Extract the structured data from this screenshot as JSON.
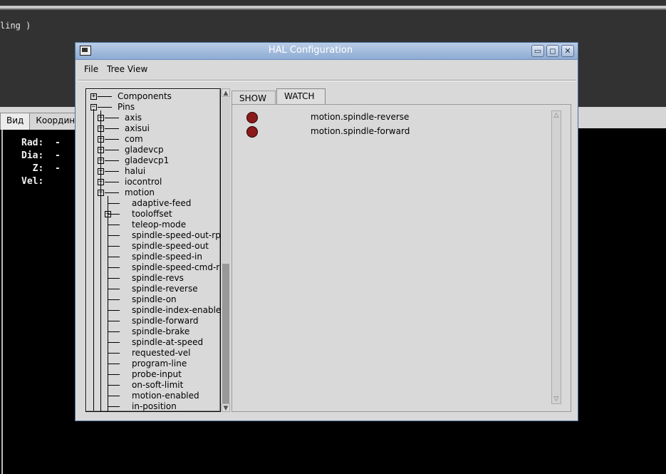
{
  "background": {
    "terminal_text": "ling )",
    "tabs": [
      {
        "label": "Вид"
      },
      {
        "label": "Координ"
      }
    ],
    "dro": [
      {
        "axis": "Rad:",
        "value": "-"
      },
      {
        "axis": "Dia:",
        "value": "-"
      },
      {
        "axis": "  Z:",
        "value": "-"
      },
      {
        "axis": "Vel:",
        "value": ""
      }
    ]
  },
  "window": {
    "title": "HAL Configuration",
    "controls": {
      "minimize": "▭",
      "maximize": "◻",
      "close": "✕"
    }
  },
  "menu": {
    "file": "File",
    "tree_view": "Tree View"
  },
  "tree": {
    "components": "Components",
    "pins": "Pins",
    "pin_groups": [
      {
        "label": "axis"
      },
      {
        "label": "axisui"
      },
      {
        "label": "com"
      },
      {
        "label": "gladevcp"
      },
      {
        "label": "gladevcp1"
      },
      {
        "label": "halui"
      },
      {
        "label": "iocontrol"
      },
      {
        "label": "motion"
      }
    ],
    "motion_children": [
      {
        "label": "adaptive-feed",
        "expandable": false
      },
      {
        "label": "tooloffset",
        "expandable": true
      },
      {
        "label": "teleop-mode",
        "expandable": false
      },
      {
        "label": "spindle-speed-out-rps",
        "expandable": false
      },
      {
        "label": "spindle-speed-out",
        "expandable": false
      },
      {
        "label": "spindle-speed-in",
        "expandable": false
      },
      {
        "label": "spindle-speed-cmd-rps",
        "expandable": false
      },
      {
        "label": "spindle-revs",
        "expandable": false
      },
      {
        "label": "spindle-reverse",
        "expandable": false
      },
      {
        "label": "spindle-on",
        "expandable": false
      },
      {
        "label": "spindle-index-enable",
        "expandable": false
      },
      {
        "label": "spindle-forward",
        "expandable": false
      },
      {
        "label": "spindle-brake",
        "expandable": false
      },
      {
        "label": "spindle-at-speed",
        "expandable": false
      },
      {
        "label": "requested-vel",
        "expandable": false
      },
      {
        "label": "program-line",
        "expandable": false
      },
      {
        "label": "probe-input",
        "expandable": false
      },
      {
        "label": "on-soft-limit",
        "expandable": false
      },
      {
        "label": "motion-enabled",
        "expandable": false
      },
      {
        "label": "in-position",
        "expandable": false
      }
    ]
  },
  "notebook": {
    "tabs": {
      "show": "SHOW",
      "watch": "WATCH"
    },
    "active_tab": "WATCH"
  },
  "watch": {
    "items": [
      {
        "name": "motion.spindle-reverse",
        "state": "off",
        "led_color": "#8b1a1a"
      },
      {
        "name": "motion.spindle-forward",
        "state": "off",
        "led_color": "#8b1a1a"
      }
    ]
  },
  "colors": {
    "titlebar": "#9cb6dc",
    "led_off": "#8b1a1a",
    "window_bg": "#d9d9d9"
  }
}
